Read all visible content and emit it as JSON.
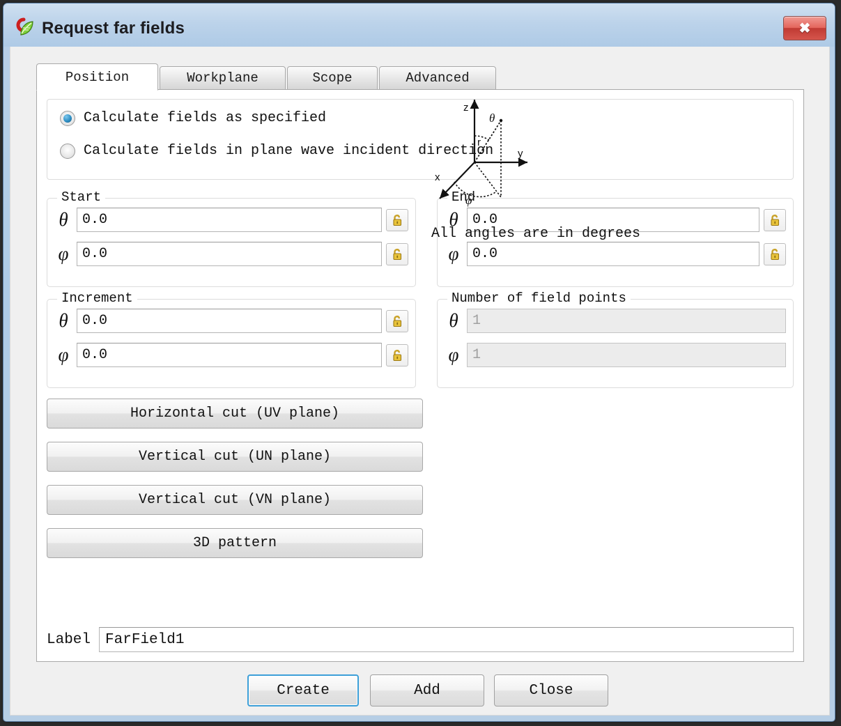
{
  "window": {
    "title": "Request far fields",
    "icon": "app-leaf-icon",
    "close_label": "✖",
    "frame_color": "#aecbe6",
    "titlebar_color": "#bcd3ea",
    "close_color": "#d5554c"
  },
  "tabs": [
    {
      "label": "Position",
      "active": true
    },
    {
      "label": "Workplane",
      "active": false
    },
    {
      "label": "Scope",
      "active": false
    },
    {
      "label": "Advanced",
      "active": false
    }
  ],
  "mode_options": [
    {
      "label": "Calculate fields as specified",
      "checked": true
    },
    {
      "label": "Calculate fields in plane wave incident direction",
      "checked": false
    }
  ],
  "groups": {
    "start": {
      "legend": "Start",
      "rows": [
        {
          "symbol": "θ",
          "value": "0.0",
          "lock": "unlocked-padlock-icon",
          "disabled": false
        },
        {
          "symbol": "φ",
          "value": "0.0",
          "lock": "unlocked-padlock-icon",
          "disabled": false
        }
      ]
    },
    "end": {
      "legend": "End",
      "rows": [
        {
          "symbol": "θ",
          "value": "0.0",
          "lock": "unlocked-padlock-icon",
          "disabled": false
        },
        {
          "symbol": "φ",
          "value": "0.0",
          "lock": "unlocked-padlock-icon",
          "disabled": false
        }
      ]
    },
    "increment": {
      "legend": "Increment",
      "rows": [
        {
          "symbol": "θ",
          "value": "0.0",
          "lock": "unlocked-padlock-icon",
          "disabled": false
        },
        {
          "symbol": "φ",
          "value": "0.0",
          "lock": "unlocked-padlock-icon",
          "disabled": false
        }
      ]
    },
    "field_points": {
      "legend": "Number of field points",
      "rows": [
        {
          "symbol": "θ",
          "value": "1",
          "lock": null,
          "disabled": true
        },
        {
          "symbol": "φ",
          "value": "1",
          "lock": null,
          "disabled": true
        }
      ]
    }
  },
  "cut_buttons": [
    {
      "label": "Horizontal cut (UV plane)"
    },
    {
      "label": "Vertical cut (UN plane)"
    },
    {
      "label": "Vertical cut (VN plane)"
    },
    {
      "label": "3D pattern"
    }
  ],
  "diagram": {
    "name": "spherical-coordinates-diagram",
    "axis_x": "x",
    "axis_y": "y",
    "axis_z": "z",
    "radius": "r",
    "theta": "θ",
    "phi": "φ"
  },
  "degrees_note": "All angles are in degrees",
  "label_field": {
    "caption": "Label",
    "value": "FarField1",
    "placeholder": ""
  },
  "footer_buttons": [
    {
      "label": "Create",
      "default": true
    },
    {
      "label": "Add",
      "default": false
    },
    {
      "label": "Close",
      "default": false
    }
  ]
}
